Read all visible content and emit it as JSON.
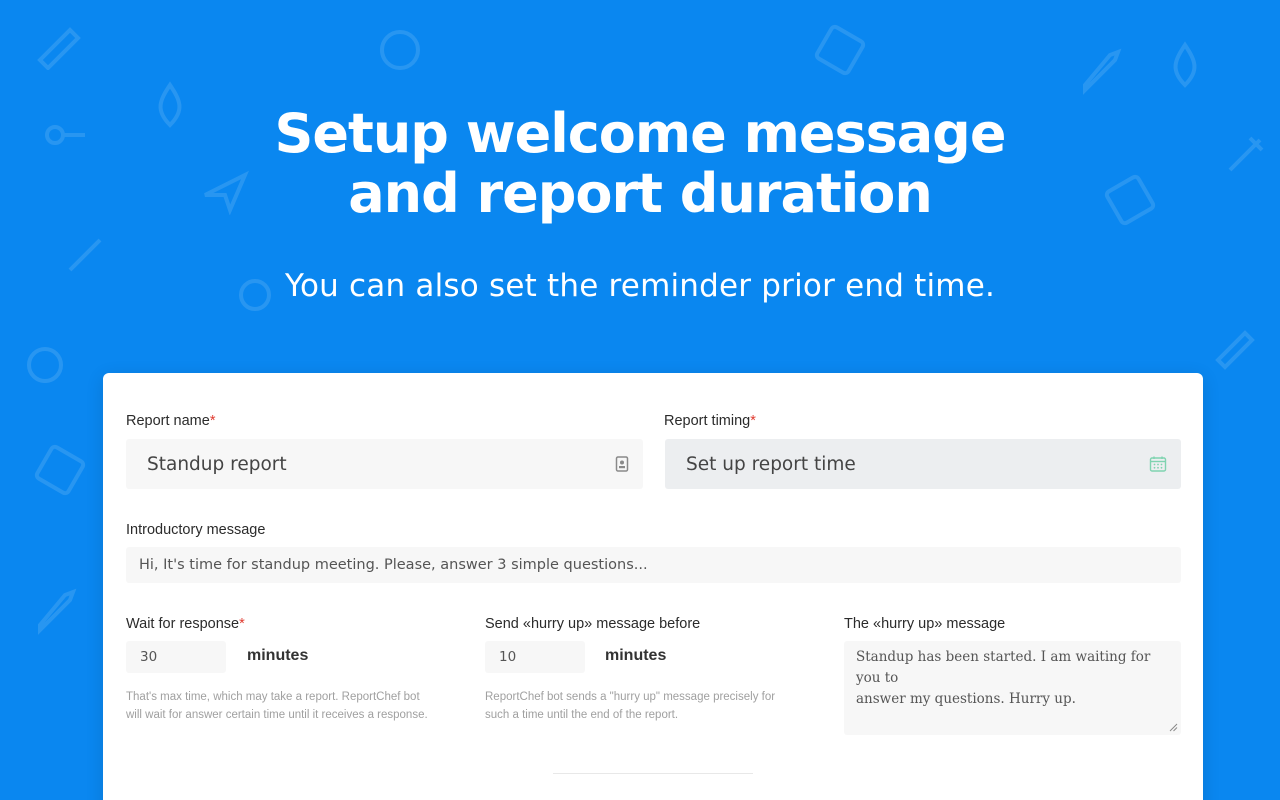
{
  "hero": {
    "title_line1": "Setup welcome message",
    "title_line2": "and report duration",
    "subtitle": "You can also set the reminder prior end time."
  },
  "form": {
    "report_name": {
      "label": "Report name",
      "required_mark": "*",
      "value": "Standup report",
      "icon": "contact-card-icon"
    },
    "report_timing": {
      "label": "Report timing",
      "required_mark": "*",
      "placeholder": "Set up report time",
      "icon": "calendar-icon"
    },
    "intro": {
      "label": "Introductory message",
      "value": "Hi, It's time for standup meeting. Please, answer 3 simple questions..."
    },
    "wait": {
      "label": "Wait for response",
      "required_mark": "*",
      "value": "30",
      "unit": "minutes",
      "hint_line1": "That's max time, which may take a report. ReportChef bot",
      "hint_line2": "will wait for answer certain time until it receives a response."
    },
    "hurry_before": {
      "label": "Send «hurry up» message before",
      "value": "10",
      "unit": "minutes",
      "hint_line1": "ReportChef bot sends a \"hurry up\" message precisely for",
      "hint_line2": "such a time until the end of the report."
    },
    "hurry_message": {
      "label": "The «hurry up» message",
      "line1": "Standup has been started. I am waiting for you to",
      "line2": "answer my questions. Hurry up."
    }
  },
  "colors": {
    "background": "#0a87f0",
    "required": "#e03a2f",
    "calendar_icon": "#7fd3b0"
  }
}
